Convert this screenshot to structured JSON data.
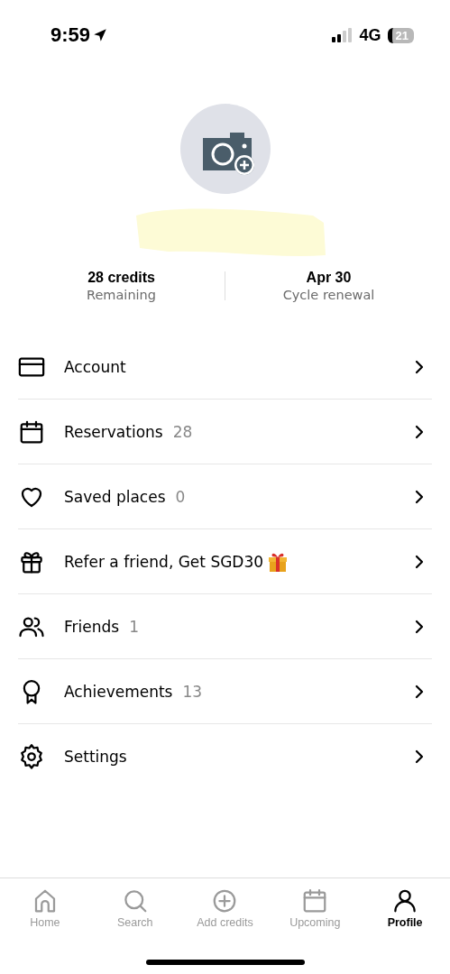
{
  "status_bar": {
    "time": "9:59",
    "network": "4G",
    "battery": "21"
  },
  "stats": [
    {
      "value": "28 credits",
      "label": "Remaining"
    },
    {
      "value": "Apr 30",
      "label": "Cycle renewal"
    }
  ],
  "menu": [
    {
      "label": "Account"
    },
    {
      "label": "Reservations",
      "count": "28"
    },
    {
      "label": "Saved places",
      "count": "0"
    },
    {
      "label": "Refer a friend, Get SGD30",
      "kind": "gift"
    },
    {
      "label": "Friends",
      "count": "1"
    },
    {
      "label": "Achievements",
      "count": "13"
    },
    {
      "label": "Settings"
    }
  ],
  "tab_bar": [
    {
      "label": "Home",
      "selected": false
    },
    {
      "label": "Search",
      "selected": false
    },
    {
      "label": "Add credits",
      "selected": false
    },
    {
      "label": "Upcoming",
      "selected": false
    },
    {
      "label": "Profile",
      "selected": true
    }
  ]
}
